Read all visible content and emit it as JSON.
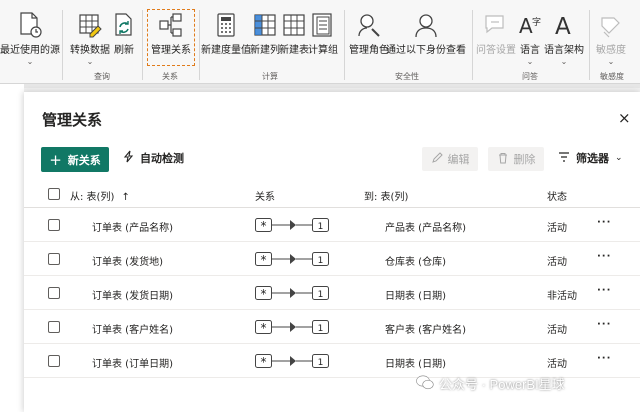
{
  "ribbon": {
    "buttons": [
      {
        "label": "最近使用的源",
        "chevron": "⌄"
      },
      {
        "label": "转换数据",
        "chevron": "⌄"
      },
      {
        "label": "刷新"
      },
      {
        "label": "管理关系"
      },
      {
        "label": "新建度量值"
      },
      {
        "label": "新建列"
      },
      {
        "label": "新建表"
      },
      {
        "label": "计算组"
      },
      {
        "label": "管理角色"
      },
      {
        "label": "通过以下身份查看"
      },
      {
        "label": "问答设置"
      },
      {
        "label": "语言",
        "chevron": "⌄"
      },
      {
        "label": "语言架构",
        "chevron": "⌄"
      },
      {
        "label": "敏感度",
        "chevron": "⌄"
      }
    ],
    "groups": [
      "查询",
      "关系",
      "计算",
      "安全性",
      "问答",
      "敏感度"
    ]
  },
  "dialog": {
    "title": "管理关系",
    "close": "×",
    "new_label": "新关系",
    "auto_label": "自动检测",
    "edit_label": "编辑",
    "delete_label": "删除",
    "filter_label": "筛选器",
    "columns": {
      "from": "从: 表(列)",
      "relation": "关系",
      "to": "到: 表(列)",
      "status": "状态"
    },
    "rows": [
      {
        "from": "订单表 (产品名称)",
        "to": "产品表 (产品名称)",
        "status": "活动",
        "more": "···"
      },
      {
        "from": "订单表 (发货地)",
        "to": "仓库表 (仓库)",
        "status": "活动",
        "more": "···"
      },
      {
        "from": "订单表 (发货日期)",
        "to": "日期表 (日期)",
        "status": "非活动",
        "more": "···"
      },
      {
        "from": "订单表 (客户姓名)",
        "to": "客户表 (客户姓名)",
        "status": "活动",
        "more": "···"
      },
      {
        "from": "订单表 (订单日期)",
        "to": "日期表 (日期)",
        "status": "活动",
        "more": "···"
      }
    ],
    "cardinality": {
      "many": "*",
      "one": "1"
    }
  },
  "watermark": "公众号 · PowerBI星球",
  "colors": {
    "accent": "#117865",
    "highlight_border": "#e07b1a"
  }
}
